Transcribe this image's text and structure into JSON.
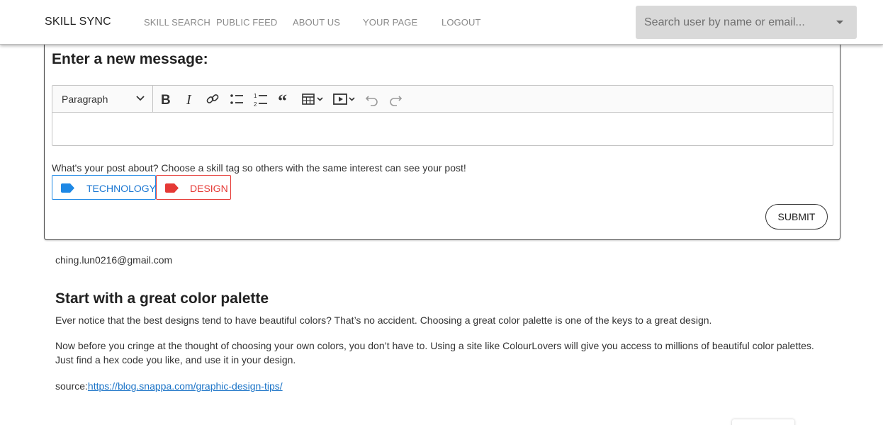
{
  "navbar": {
    "brand": "SKILL SYNC",
    "links": [
      "SKILL SEARCH",
      "PUBLIC FEED",
      "ABOUT US",
      "YOUR PAGE",
      "LOGOUT"
    ],
    "search": {
      "placeholder": "Search user by name or email...",
      "value": ""
    }
  },
  "composer": {
    "title": "Enter a new message:",
    "heading_select": "Paragraph",
    "toolbar_icons": [
      "bold-icon",
      "italic-icon",
      "link-icon",
      "bulleted-list-icon",
      "numbered-list-icon",
      "blockquote-icon",
      "table-icon",
      "media-embed-icon",
      "undo-icon",
      "redo-icon"
    ],
    "tag_prompt": "What's your post about? Choose a skill tag so others with the same interest can see your post!",
    "tags": [
      {
        "label": "TECHNOLOGY",
        "color": "#1e88e5"
      },
      {
        "label": "DESIGN",
        "color": "#e53935"
      }
    ],
    "submit_label": "SUBMIT"
  },
  "post": {
    "author": "ching.lun0216@gmail.com",
    "title": "Start with a great color palette",
    "paragraphs": [
      "Ever notice that the best designs tend to have beautiful colors? That’s no accident. Choosing a great color palette is one of the keys to a great design.",
      "Now before you cringe at the thought of choosing your own colors, you don’t have to. Using a site like ColourLovers will give you access to millions of beautiful color palettes. Just find a hex code you like, and use it in your design."
    ],
    "source_label": "source:",
    "source_link": "https://blog.snappa.com/graphic-design-tips/"
  }
}
